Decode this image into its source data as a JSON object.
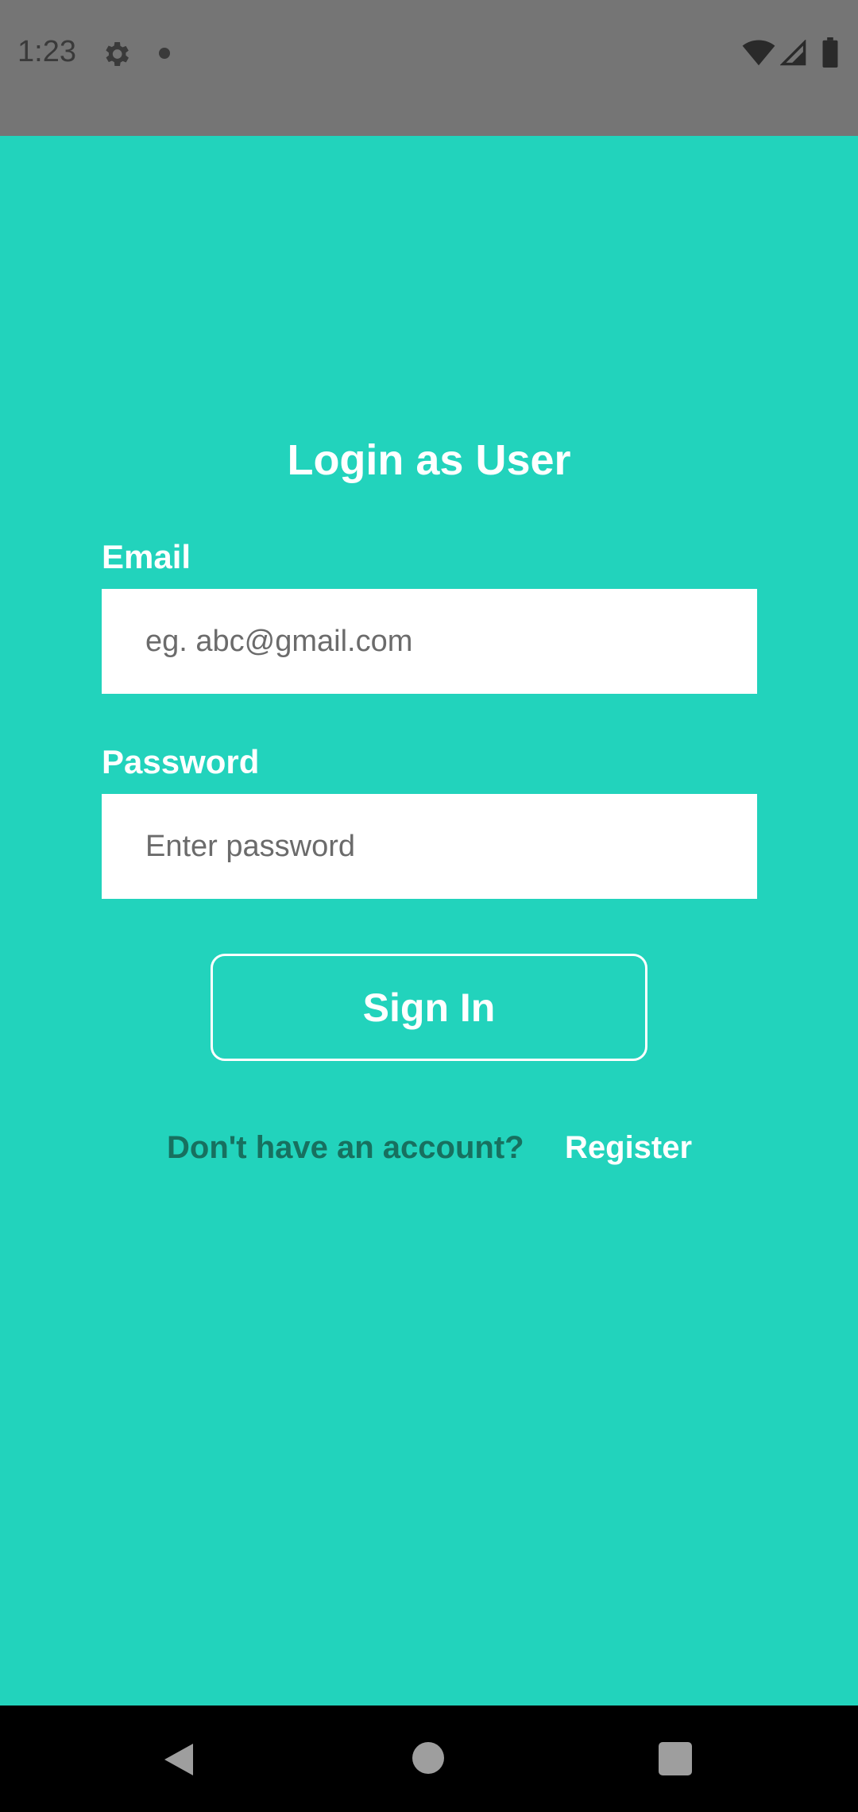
{
  "status_bar": {
    "time": "1:23",
    "icons": [
      "gear-icon",
      "notification-dot",
      "wifi-icon",
      "cell-signal-icon",
      "battery-icon"
    ]
  },
  "login": {
    "title": "Login as User",
    "email_label": "Email",
    "email_placeholder": "eg. abc@gmail.com",
    "email_value": "",
    "password_label": "Password",
    "password_placeholder": "Enter password",
    "password_value": "",
    "sign_in_label": "Sign In",
    "no_account_text": "Don't have an account?",
    "register_label": "Register"
  },
  "nav_bar": {
    "icons": [
      "back-icon",
      "home-icon",
      "recents-icon"
    ]
  },
  "colors": {
    "background": "#22D3BC",
    "status_bar": "#757575",
    "nav_bar": "#000000",
    "text_primary": "#FFFFFF",
    "text_secondary": "#17705F"
  }
}
